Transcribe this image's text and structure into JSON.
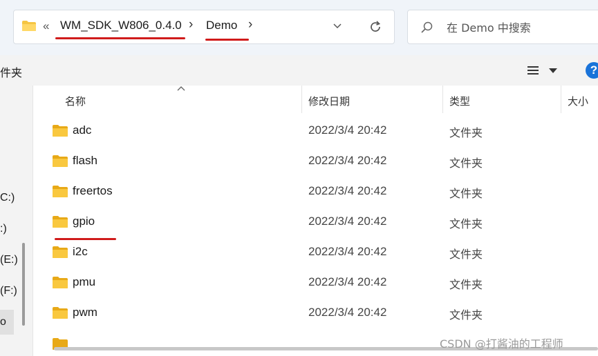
{
  "address": {
    "overflow_glyph": "«",
    "crumbs": [
      "WM_SDK_W806_0.4.0",
      "Demo"
    ],
    "separator": "›"
  },
  "search": {
    "placeholder": "在 Demo 中搜索"
  },
  "toolbar": {
    "label": "件夹",
    "help": "?"
  },
  "nav": {
    "drives": [
      "C:)",
      ":)",
      "(E:)",
      "(F:)",
      "o"
    ]
  },
  "columns": {
    "name": "名称",
    "modified": "修改日期",
    "type": "类型",
    "size": "大小"
  },
  "files": [
    {
      "name": "adc",
      "modified": "2022/3/4 20:42",
      "type": "文件夹"
    },
    {
      "name": "flash",
      "modified": "2022/3/4 20:42",
      "type": "文件夹"
    },
    {
      "name": "freertos",
      "modified": "2022/3/4 20:42",
      "type": "文件夹"
    },
    {
      "name": "gpio",
      "modified": "2022/3/4 20:42",
      "type": "文件夹"
    },
    {
      "name": "i2c",
      "modified": "2022/3/4 20:42",
      "type": "文件夹"
    },
    {
      "name": "pmu",
      "modified": "2022/3/4 20:42",
      "type": "文件夹"
    },
    {
      "name": "pwm",
      "modified": "2022/3/4 20:42",
      "type": "文件夹"
    }
  ],
  "watermark": "CSDN @打酱油的工程师",
  "colors": {
    "annotation_underline": "#d01b1b",
    "folder": "#f5c542",
    "accent": "#1a73d9"
  }
}
